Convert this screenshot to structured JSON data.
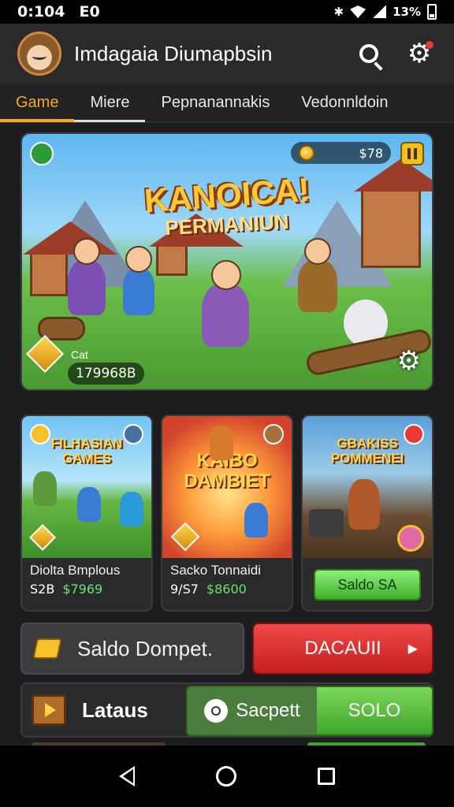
{
  "status_bar": {
    "time": "0:104",
    "extra": "E0",
    "battery_pct": "13%"
  },
  "header": {
    "title": "Imdagaia Diumapbsin"
  },
  "tabs": [
    {
      "label": "Game"
    },
    {
      "label": "Miere"
    },
    {
      "label": "Pepnanannakis"
    },
    {
      "label": "Vedonnldoin"
    }
  ],
  "hero": {
    "title": "KANOICA!",
    "subtitle": "PERMANIUN",
    "coin_value": "$78",
    "counter_label": "Cat",
    "counter_value": "179968B"
  },
  "cards": [
    {
      "art_title": "FILHASIAN\nGAMES",
      "name": "Diolta Bmplous",
      "count": "S2B",
      "price": "$7969"
    },
    {
      "art_title": "KAIBO\nDAMBIET",
      "name": "Sacko Tonnaidi",
      "count": "9/S7",
      "price": "$8600"
    },
    {
      "art_title": "GBAKISS\nPOMMENEI",
      "cta": "Saldo SA"
    }
  ],
  "wallet": {
    "label": "Saldo Dompet.",
    "action": "DACAUII"
  },
  "bottom": {
    "label": "Lataus",
    "left_button": "Sacpett",
    "right_button": "SOLO"
  },
  "colors": {
    "accent": "#f5a623",
    "danger": "#d92c2c",
    "success": "#3fa52a"
  }
}
